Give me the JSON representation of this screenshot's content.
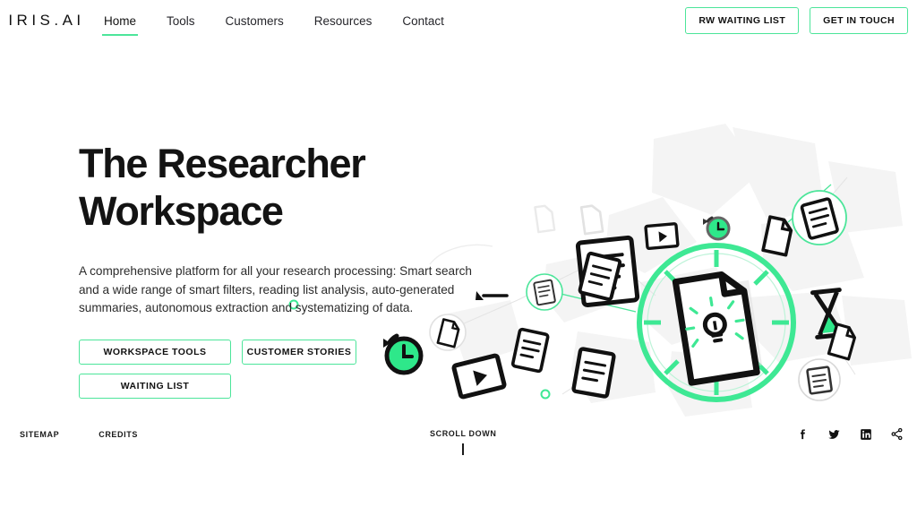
{
  "brand": {
    "logo": "IRIS.AI",
    "accent": "#4ce59a",
    "text": "#131313"
  },
  "nav": {
    "items": [
      {
        "label": "Home",
        "active": true
      },
      {
        "label": "Tools",
        "active": false
      },
      {
        "label": "Customers",
        "active": false
      },
      {
        "label": "Resources",
        "active": false
      },
      {
        "label": "Contact",
        "active": false
      }
    ]
  },
  "header_actions": {
    "waiting_list": "RW WAITING LIST",
    "get_in_touch": "GET IN TOUCH"
  },
  "hero": {
    "title_line1": "The Researcher",
    "title_line2": "Workspace",
    "paragraph": "A comprehensive platform for all your research processing: Smart search and a wide range of smart filters, reading list analysis, auto-generated summaries, autonomous extraction and systematizing of data.",
    "cta_workspace": "WORKSPACE TOOLS",
    "cta_stories": "CUSTOMER STORIES",
    "cta_waiting": "WAITING LIST"
  },
  "illustration": {
    "center_icon": "document-lightbulb-icon",
    "nodes": [
      "document-lines-icon",
      "video-play-icon",
      "clock-history-icon",
      "hourglass-icon",
      "blank-document-icon",
      "document-circle-icon"
    ]
  },
  "footer": {
    "sitemap": "SITEMAP",
    "credits": "CREDITS",
    "scroll_down": "SCROLL DOWN",
    "socials": [
      {
        "name": "facebook-icon"
      },
      {
        "name": "twitter-icon"
      },
      {
        "name": "linkedin-icon"
      },
      {
        "name": "share-icon"
      }
    ]
  }
}
